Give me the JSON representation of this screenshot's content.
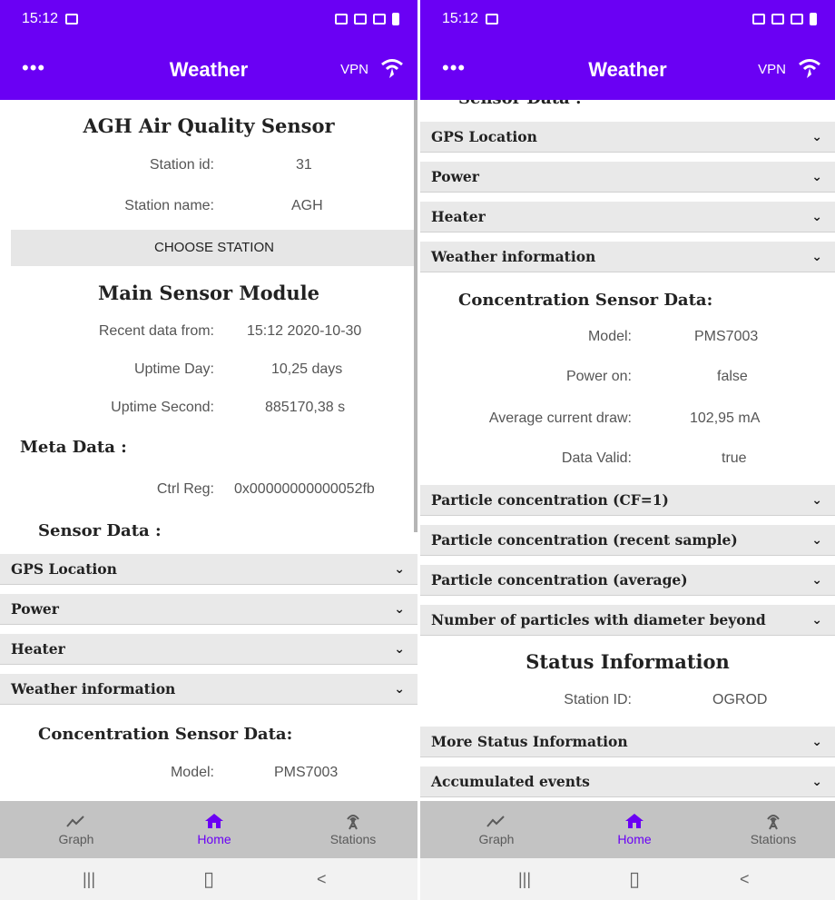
{
  "status": {
    "time": "15:12"
  },
  "appbar": {
    "menu": "•••",
    "title": "Weather",
    "vpn": "VPN"
  },
  "left": {
    "sensor_title": "AGH Air Quality Sensor",
    "station_id_label": "Station id:",
    "station_id_value": "31",
    "station_name_label": "Station name:",
    "station_name_value": "AGH",
    "choose_station": "CHOOSE STATION",
    "main_module_title": "Main Sensor Module",
    "recent_label": "Recent data from:",
    "recent_value": "15:12  2020-10-30",
    "uptime_day_label": "Uptime Day:",
    "uptime_day_value": "10,25 days",
    "uptime_second_label": "Uptime Second:",
    "uptime_second_value": "885170,38 s",
    "meta_title": "Meta Data :",
    "ctrl_label": "Ctrl Reg:",
    "ctrl_value": "0x00000000000052fb",
    "sensor_data_title": "Sensor Data :",
    "accordions": [
      "GPS Location",
      "Power",
      "Heater",
      "Weather information"
    ],
    "conc_title": "Concentration Sensor Data:",
    "model_label": "Model:",
    "model_value": "PMS7003"
  },
  "right": {
    "partial_title": "Sensor Data :",
    "accordions_top": [
      "GPS Location",
      "Power",
      "Heater",
      "Weather information"
    ],
    "conc_title": "Concentration Sensor Data:",
    "model_label": "Model:",
    "model_value": "PMS7003",
    "power_label": "Power on:",
    "power_value": "false",
    "current_label": "Average current draw:",
    "current_value": "102,95 mA",
    "valid_label": "Data Valid:",
    "valid_value": "true",
    "accordions_mid": [
      "Particle concentration (CF=1)",
      "Particle concentration (recent sample)",
      "Particle concentration (average)",
      "Number of particles with diameter beyond"
    ],
    "status_title": "Status Information",
    "station_id_label": "Station ID:",
    "station_id_value": "OGROD",
    "accordions_bottom": [
      "More Status Information",
      "Accumulated events"
    ]
  },
  "nav": {
    "graph": "Graph",
    "home": "Home",
    "stations": "Stations"
  },
  "icons": {
    "chevron": "⌵",
    "menu": "more-dots-icon",
    "wifi": "wifi-icon",
    "graph": "graph-icon",
    "home": "home-icon",
    "stations": "antenna-icon"
  },
  "sysnav": {
    "recents": "|||",
    "home": "▯",
    "back": "<"
  },
  "colors": {
    "accent": "#6a00f4",
    "accordion_bg": "#e9e9e9",
    "nav_bg": "#c3c3c3"
  }
}
